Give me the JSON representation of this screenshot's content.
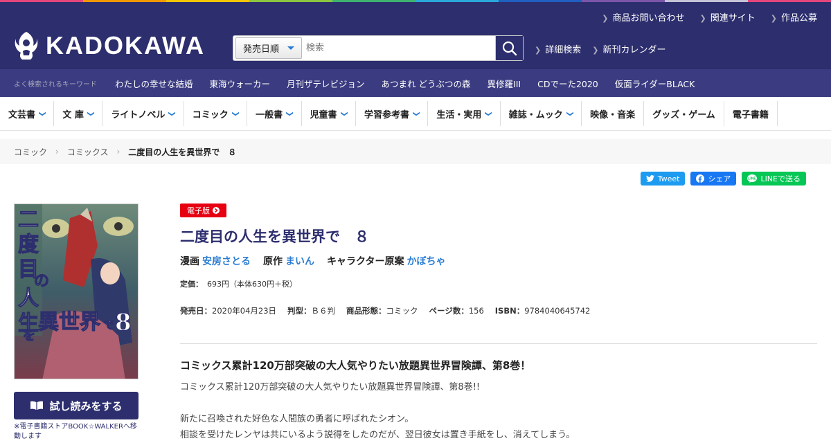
{
  "top_strip_colors": [
    "#e4467c",
    "#f39800",
    "#f7c600",
    "#8cc63f",
    "#3eb370",
    "#2aa7d9",
    "#1e5fbf",
    "#7b56a8",
    "#c4c4d8",
    "#e4467c"
  ],
  "header": {
    "logo_text": "KADOKAWA",
    "util_links": [
      "商品お問い合わせ",
      "関連サイト",
      "作品公募"
    ],
    "search": {
      "select_value": "発売日順",
      "placeholder": "検索"
    },
    "links": [
      "詳細検索",
      "新刊カレンダー"
    ]
  },
  "keywords": {
    "label": "よく検索されるキーワード",
    "items": [
      "わたしの幸せな結婚",
      "東海ウォーカー",
      "月刊ザテレビジョン",
      "あつまれ どうぶつの森",
      "異修羅III",
      "CDでーた2020",
      "仮面ライダーBLACK"
    ]
  },
  "categories": [
    {
      "label": "文芸書",
      "dropdown": true
    },
    {
      "label": "文 庫",
      "dropdown": true
    },
    {
      "label": "ライトノベル",
      "dropdown": true
    },
    {
      "label": "コミック",
      "dropdown": true
    },
    {
      "label": "一般書",
      "dropdown": true
    },
    {
      "label": "児童書",
      "dropdown": true
    },
    {
      "label": "学習参考書",
      "dropdown": true
    },
    {
      "label": "生活・実用",
      "dropdown": true
    },
    {
      "label": "雑誌・ムック",
      "dropdown": true
    },
    {
      "label": "映像・音楽",
      "dropdown": false
    },
    {
      "label": "グッズ・ゲーム",
      "dropdown": false
    },
    {
      "label": "電子書籍",
      "dropdown": false
    }
  ],
  "breadcrumb": [
    "コミック",
    "コミックス",
    "二度目の人生を異世界で　８"
  ],
  "share": {
    "tweet": "Tweet",
    "facebook": "シェア",
    "line": "LINEで送る"
  },
  "product": {
    "badge": "電子版",
    "title": "二度目の人生を異世界で　８",
    "roles": [
      {
        "role": "漫画",
        "name": "安房さとる"
      },
      {
        "role": "原作",
        "name": "まいん"
      },
      {
        "role": "キャラクター原案",
        "name": "かぼちゃ"
      }
    ],
    "price_label": "定価：",
    "price": "693円（本体630円＋税）",
    "specs": [
      {
        "label": "発売日：",
        "value": "2020年04月23日"
      },
      {
        "label": "判型：",
        "value": "Ｂ６判"
      },
      {
        "label": "商品形態：",
        "value": "コミック"
      },
      {
        "label": "ページ数：",
        "value": "156"
      },
      {
        "label": "ISBN：",
        "value": "9784040645742"
      }
    ],
    "catchcopy": "コミックス累計120万部突破の大人気やりたい放題異世界冒険譚、第8巻！",
    "description": [
      "コミックス累計120万部突破の大人気やりたい放題異世界冒険譚、第8巻!!",
      "",
      "新たに召喚された好色な人間族の勇者に呼ばれたシオン。",
      "相談を受けたレンヤは共にいるよう説得をしたのだが、翌日彼女は置き手紙をし、消えてしまう。"
    ],
    "trial_button": "試し読みをする",
    "trial_note": "※電子書籍ストアBOOK☆WALKERへ移動します"
  },
  "cover": {
    "title_text": "二度目の人生を異世界で8"
  }
}
